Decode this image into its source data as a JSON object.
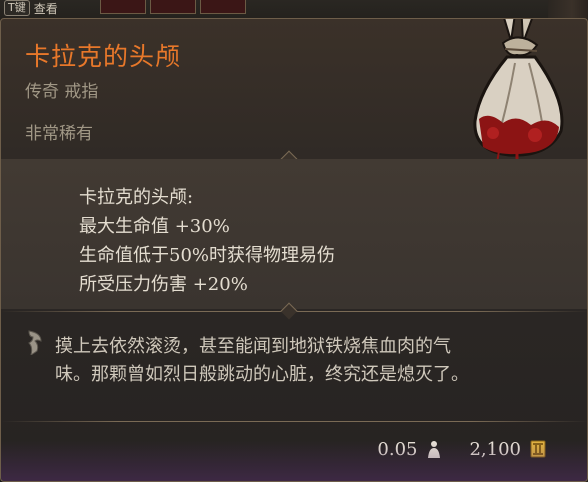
{
  "hud": {
    "key_label": "T键",
    "key_action": "查看"
  },
  "item": {
    "name": "卡拉克的头颅",
    "type": "传奇 戒指",
    "rarity": "非常稀有",
    "name_color": "#e8782a",
    "icon": "severed-head-sack-icon"
  },
  "effects": {
    "header": "卡拉克的头颅:",
    "lines": [
      "最大生命值 +30%",
      "生命值低于50%时获得物理易伤",
      "所受压力伤害 +20%"
    ]
  },
  "lore": {
    "icon": "quill-icon",
    "line1": "摸上去依然滚烫，甚至能闻到地狱铁烧焦血肉的气",
    "line2": "味。那颗曾如烈日般跳动的心脏，终究还是熄灭了。"
  },
  "footer": {
    "weight": "0.05",
    "weight_icon": "weight-icon",
    "value": "2,100",
    "value_icon": "gold-coin-icon"
  }
}
